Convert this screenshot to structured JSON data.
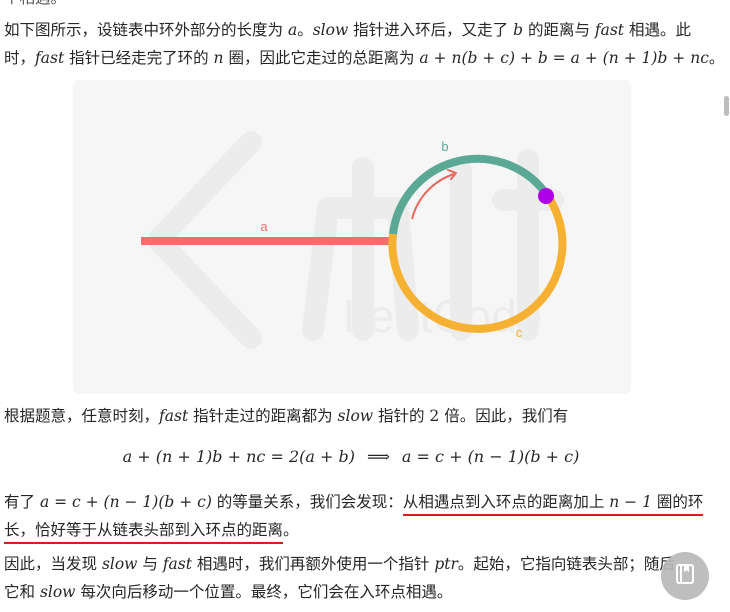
{
  "top_clip": "个相遇。",
  "p1": {
    "l1_t1": "如下图所示，设链表中环外部分的长度为 ",
    "l1_m1": "a",
    "l1_t2": "。",
    "l1_m2": "slow",
    "l1_t3": " 指针进入环后，又走了 ",
    "l1_m3": "b",
    "l1_t4": " 的距离与 ",
    "l1_m4": "fast",
    "l1_t5": " 相遇。此",
    "l2_t1": "时，",
    "l2_m1": "fast",
    "l2_t2": " 指针已经走完了环的 ",
    "l2_m2": "n",
    "l2_t3": " 圈，因此它走过的总距离为 ",
    "l2_eq": "a + n(b + c) + b = a + (n + 1)b + nc",
    "l2_t4": "。"
  },
  "figure": {
    "label_a": "a",
    "label_b": "b",
    "label_c": "c",
    "watermark_text": "LeetCode",
    "colors": {
      "a": "#ef6f6c",
      "b": "#5ba895",
      "c": "#f6b132",
      "meet": "#b000e8",
      "arrow": "#e8675d"
    }
  },
  "p2": {
    "t1": "根据题意，任意时刻，",
    "m1": "fast",
    "t2": " 指针走过的距离都为 ",
    "m2": "slow",
    "t3": " 指针的 ",
    "num": "2",
    "t4": " 倍。因此，我们有"
  },
  "formula": {
    "left": "a + (n + 1)b + nc = 2(a + b)",
    "arrow": "⟹",
    "right": "a = c + (n − 1)(b + c)"
  },
  "p3": {
    "t1": "有了 ",
    "eq": "a = c + (n − 1)(b + c)",
    "t2": " 的等量关系，我们会发现：",
    "u1": "从相遇点到入环点的距离加上 ",
    "u_eq": "n − 1",
    "u2": " 圈的环",
    "u3": "长，恰好等于从链表头部到入环点的距离",
    "t3": "。"
  },
  "p4": {
    "l1_t1": "因此，当发现 ",
    "l1_m1": "slow",
    "l1_t2": " 与 ",
    "l1_m2": "fast",
    "l1_t3": " 相遇时，我们再额外使用一个指针 ",
    "l1_m3": "ptr",
    "l1_t4": "。起始，它指向链表头部；随后，",
    "l2_t1": "它和 ",
    "l2_m1": "slow",
    "l2_t2": " 每次向后移动一个位置。最终，它们会在入环点相遇。"
  },
  "fab_icon": "book-icon"
}
